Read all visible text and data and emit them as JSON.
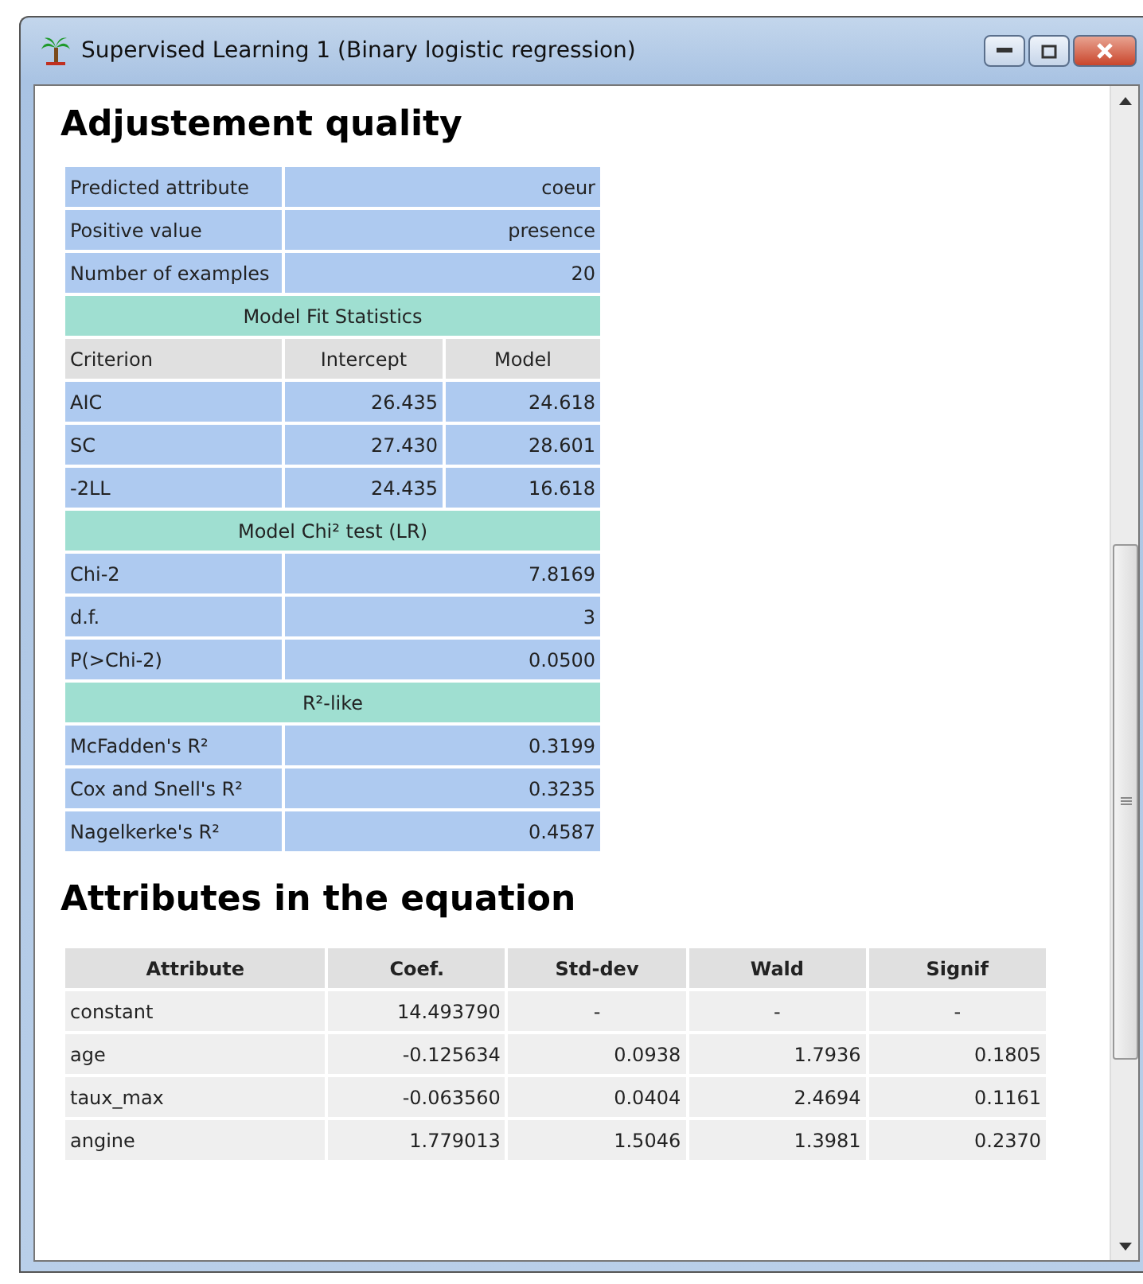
{
  "window": {
    "title": "Supervised Learning 1 (Binary logistic regression)"
  },
  "quality": {
    "heading": "Adjustement quality",
    "blocks": [
      {
        "rows": [
          [
            "Predicted attribute",
            "coeur"
          ],
          [
            "Positive value",
            "presence"
          ],
          [
            "Number of examples",
            "20"
          ]
        ]
      },
      {
        "title": "Model Fit Statistics",
        "columns": [
          "Criterion",
          "Intercept",
          "Model"
        ],
        "rows": [
          [
            "AIC",
            "26.435",
            "24.618"
          ],
          [
            "SC",
            "27.430",
            "28.601"
          ],
          [
            "-2LL",
            "24.435",
            "16.618"
          ]
        ]
      },
      {
        "title": "Model Chi² test (LR)",
        "rows": [
          [
            "Chi-2",
            "7.8169"
          ],
          [
            "d.f.",
            "3"
          ],
          [
            "P(>Chi-2)",
            "0.0500"
          ]
        ]
      },
      {
        "title": "R²-like",
        "rows": [
          [
            "McFadden's R²",
            "0.3199"
          ],
          [
            "Cox and Snell's R²",
            "0.3235"
          ],
          [
            "Nagelkerke's R²",
            "0.4587"
          ]
        ]
      }
    ]
  },
  "equation": {
    "heading": "Attributes in the equation",
    "columns": [
      "Attribute",
      "Coef.",
      "Std-dev",
      "Wald",
      "Signif"
    ],
    "rows": [
      [
        "constant",
        "14.493790",
        "-",
        "-",
        "-"
      ],
      [
        "age",
        "-0.125634",
        "0.0938",
        "1.7936",
        "0.1805"
      ],
      [
        "taux_max",
        "-0.063560",
        "0.0404",
        "2.4694",
        "0.1161"
      ],
      [
        "angine",
        "1.779013",
        "1.5046",
        "1.3981",
        "0.2370"
      ]
    ]
  }
}
